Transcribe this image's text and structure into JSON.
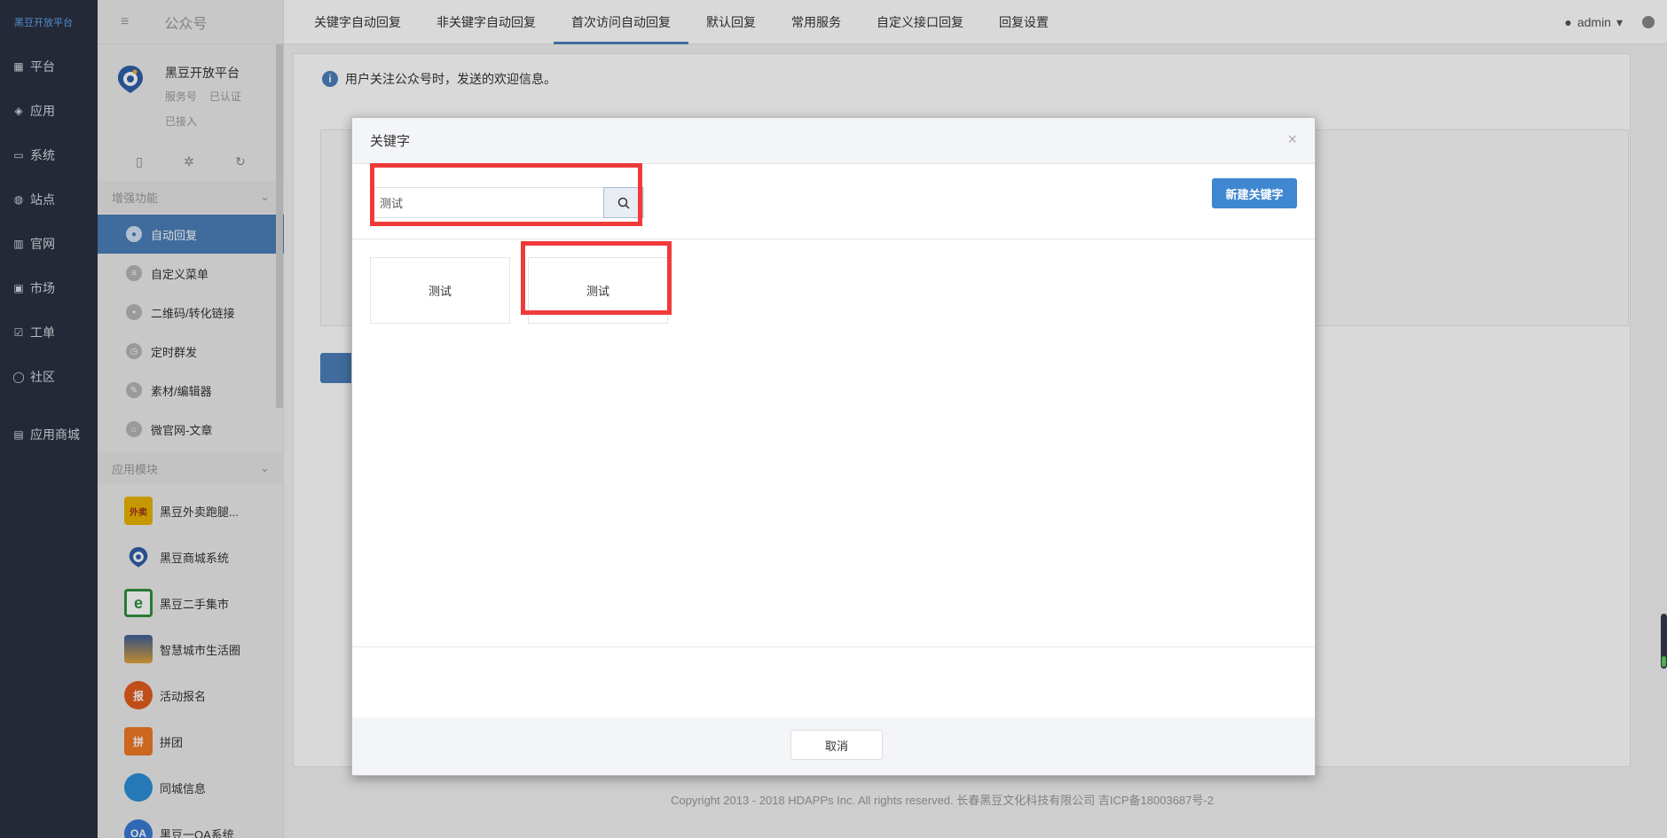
{
  "rail": {
    "logo": "黑豆开放平台",
    "items": [
      "平台",
      "应用",
      "系统",
      "站点",
      "官网",
      "市场",
      "工单",
      "社区",
      "应用商城"
    ]
  },
  "sidebar": {
    "header": "公众号",
    "account": {
      "name": "黑豆开放平台",
      "type": "服务号",
      "status": "已认证",
      "connected": "已接入"
    },
    "group_enhanced": "增强功能",
    "nav": [
      "自动回复",
      "自定义菜单",
      "二维码/转化链接",
      "定时群发",
      "素材/编辑器",
      "微官网-文章"
    ],
    "group_apps": "应用模块",
    "apps": [
      {
        "label": "黑豆外卖跑腿...",
        "icon_text": "外卖",
        "color": "#e9b300"
      },
      {
        "label": "黑豆商城系统",
        "icon_text": "",
        "color": "#3f6fb5"
      },
      {
        "label": "黑豆二手集市",
        "icon_text": "e",
        "color": "#2f8f3f"
      },
      {
        "label": "智慧城市生活圈",
        "icon_text": "",
        "color": "#4b6ea8"
      },
      {
        "label": "活动报名",
        "icon_text": "报",
        "color": "#e25c1d"
      },
      {
        "label": "拼团",
        "icon_text": "拼",
        "color": "#f07a26"
      },
      {
        "label": "同城信息",
        "icon_text": "",
        "color": "#2c8fd6"
      },
      {
        "label": "黑豆一OA系统",
        "icon_text": "OA",
        "color": "#3a7bd5"
      }
    ]
  },
  "topnav": {
    "tabs": [
      "关键字自动回复",
      "非关键字自动回复",
      "首次访问自动回复",
      "默认回复",
      "常用服务",
      "自定义接口回复",
      "回复设置"
    ],
    "active_index": 2,
    "user": "admin"
  },
  "content": {
    "notice": "用户关注公众号时，发送的欢迎信息。"
  },
  "footer": {
    "copyright": "Copyright 2013 - 2018 HDAPPs Inc. All rights reserved. 长春黑豆文化科技有限公司 吉ICP备18003687号-2"
  },
  "modal": {
    "title": "关键字",
    "search_value": "测试",
    "new_button": "新建关键字",
    "cards": [
      "测试",
      "测试"
    ],
    "cancel": "取消"
  },
  "colors": {
    "accent": "#4a7fb8",
    "primary_button": "#3f87d0",
    "highlight": "#f03a3a",
    "rail_bg": "#2b3141"
  }
}
